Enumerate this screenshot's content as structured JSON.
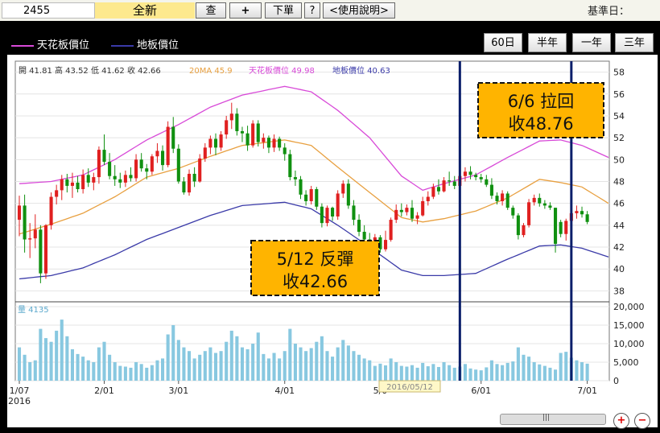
{
  "toolbar": {
    "stock_code": "2455",
    "stock_name": "全新",
    "search_label": "查",
    "add_label": "+",
    "order_label": "下單",
    "help_label": "?",
    "manual_label": "<使用說明>",
    "base_date_label": "基準日："
  },
  "legend": {
    "upper_band": "天花板價位",
    "lower_band": "地板價位",
    "upper_color": "#d84ad8",
    "lower_color": "#3a3aa8"
  },
  "ranges": [
    "60日",
    "半年",
    "一年",
    "三年"
  ],
  "info_line": {
    "ohlc": "開 41.81 高 43.52 低 41.62 收 42.66",
    "ma": "20MA 45.9",
    "upper": "天花板價位 49.98",
    "lower": "地板價位 40.63"
  },
  "volume_label": "量 4135",
  "annotations": [
    {
      "line1": "6/6 拉回",
      "line2": "收48.76",
      "date_index": 104
    },
    {
      "line1": "5/12 反彈",
      "line2": "收42.66",
      "date_index": 83
    }
  ],
  "cursor_date": "2016/05/12",
  "colors": {
    "up": "#e02020",
    "down": "#109010",
    "ma": "#e8a040",
    "volume": "#88c8e0",
    "vline": "#0a1e6a",
    "callout": "#ffb400"
  },
  "chart_data": {
    "type": "candlestick",
    "price_axis": {
      "ticks": [
        38,
        40,
        42,
        44,
        46,
        48,
        50,
        52,
        54,
        56,
        58
      ],
      "range": [
        37,
        59
      ]
    },
    "volume_axis": {
      "ticks": [
        "0",
        "5,000",
        "10,000",
        "15,000",
        "20,000"
      ],
      "range": [
        0,
        20000
      ]
    },
    "x_ticks": [
      {
        "label": "1/07\n2016",
        "index": 0
      },
      {
        "label": "2/01",
        "index": 16
      },
      {
        "label": "3/01",
        "index": 30
      },
      {
        "label": "4/01",
        "index": 50
      },
      {
        "label": "5/0",
        "index": 68
      },
      {
        "label": "6/01",
        "index": 87
      },
      {
        "label": "7/01",
        "index": 107
      }
    ],
    "n": 112,
    "series": [
      {
        "name": "天花板價位",
        "points": [
          [
            0,
            47.8
          ],
          [
            6,
            48
          ],
          [
            12,
            48.6
          ],
          [
            18,
            50
          ],
          [
            24,
            51.8
          ],
          [
            30,
            53.2
          ],
          [
            36,
            54.8
          ],
          [
            42,
            55.9
          ],
          [
            50,
            56.7
          ],
          [
            55,
            56.2
          ],
          [
            60,
            54.5
          ],
          [
            66,
            52
          ],
          [
            72,
            48.5
          ],
          [
            76,
            47.2
          ],
          [
            80,
            47.8
          ],
          [
            86,
            48.6
          ],
          [
            92,
            50.2
          ],
          [
            98,
            51.7
          ],
          [
            102,
            51.8
          ],
          [
            106,
            51.3
          ],
          [
            111,
            50.2
          ]
        ]
      },
      {
        "name": "地板價位",
        "points": [
          [
            0,
            39.1
          ],
          [
            6,
            39.4
          ],
          [
            12,
            40.1
          ],
          [
            18,
            41.3
          ],
          [
            24,
            42.7
          ],
          [
            30,
            43.8
          ],
          [
            36,
            44.9
          ],
          [
            42,
            45.8
          ],
          [
            50,
            46.1
          ],
          [
            55,
            45.5
          ],
          [
            60,
            44
          ],
          [
            66,
            42
          ],
          [
            72,
            39.9
          ],
          [
            76,
            39.4
          ],
          [
            80,
            39.4
          ],
          [
            86,
            39.6
          ],
          [
            92,
            40.9
          ],
          [
            98,
            42.1
          ],
          [
            102,
            42.2
          ],
          [
            106,
            41.9
          ],
          [
            111,
            41.1
          ]
        ]
      },
      {
        "name": "20MA",
        "points": [
          [
            0,
            43.2
          ],
          [
            6,
            44.1
          ],
          [
            12,
            45.1
          ],
          [
            18,
            46.6
          ],
          [
            24,
            48.4
          ],
          [
            30,
            49.2
          ],
          [
            36,
            50.3
          ],
          [
            42,
            51.3
          ],
          [
            50,
            51.8
          ],
          [
            55,
            51.3
          ],
          [
            60,
            49.3
          ],
          [
            66,
            47
          ],
          [
            72,
            44.7
          ],
          [
            76,
            44.3
          ],
          [
            80,
            44.6
          ],
          [
            86,
            45.3
          ],
          [
            92,
            46.5
          ],
          [
            98,
            48.2
          ],
          [
            102,
            47.9
          ],
          [
            106,
            47.5
          ],
          [
            111,
            46
          ]
        ]
      }
    ],
    "candles": [
      [
        44.5,
        46.7,
        43,
        45.8,
        9000
      ],
      [
        45.8,
        46.8,
        41.5,
        42.7,
        7000
      ],
      [
        42.7,
        44.2,
        41,
        42.8,
        5000
      ],
      [
        42.8,
        45,
        41.9,
        43.6,
        5500
      ],
      [
        43.6,
        44,
        38.7,
        39.6,
        14000
      ],
      [
        39.6,
        44.1,
        39.1,
        44,
        11500
      ],
      [
        44,
        47,
        43.6,
        46.6,
        10500
      ],
      [
        46.6,
        47.7,
        45.9,
        47.2,
        13500
      ],
      [
        47.2,
        48.6,
        46.3,
        48.2,
        16500
      ],
      [
        48.2,
        48.7,
        47,
        47.6,
        12000
      ],
      [
        47.6,
        48.8,
        46.5,
        47.9,
        8500
      ],
      [
        47.9,
        48.5,
        47,
        47.3,
        7200
      ],
      [
        47.3,
        49.1,
        46.9,
        48.6,
        6500
      ],
      [
        48.6,
        49.2,
        47.5,
        47.9,
        5500
      ],
      [
        47.9,
        48.8,
        47.2,
        48.4,
        5000
      ],
      [
        48.4,
        51.2,
        47.8,
        50.9,
        9000
      ],
      [
        50.9,
        52.3,
        49.5,
        49.8,
        10500
      ],
      [
        49.8,
        50.6,
        48.2,
        48.5,
        7000
      ],
      [
        48.5,
        49.5,
        47.6,
        48.2,
        5000
      ],
      [
        48.2,
        48.8,
        47.4,
        47.9,
        4000
      ],
      [
        47.9,
        49,
        47.5,
        48.6,
        3800
      ],
      [
        48.6,
        49.3,
        48,
        48.3,
        3500
      ],
      [
        48.3,
        50.5,
        48,
        50,
        5000
      ],
      [
        50,
        50.6,
        48.9,
        49.2,
        4500
      ],
      [
        49.2,
        49.6,
        48.2,
        48.9,
        3500
      ],
      [
        48.9,
        50.5,
        48.6,
        50.3,
        4200
      ],
      [
        50.3,
        51.5,
        49.7,
        50.8,
        5500
      ],
      [
        50.8,
        51.3,
        49,
        49.5,
        6000
      ],
      [
        49.5,
        53.5,
        49.3,
        53,
        12500
      ],
      [
        53,
        53.9,
        50.6,
        51,
        15000
      ],
      [
        51,
        51.4,
        47.8,
        48,
        11000
      ],
      [
        48,
        48.4,
        46.8,
        47,
        9000
      ],
      [
        47,
        49.1,
        46.7,
        48.7,
        8000
      ],
      [
        48.7,
        49.3,
        47.5,
        48,
        6000
      ],
      [
        48,
        50.5,
        47.9,
        50.1,
        7000
      ],
      [
        50.1,
        51.5,
        49.8,
        51.1,
        8000
      ],
      [
        51.1,
        52.2,
        50.5,
        51.9,
        9000
      ],
      [
        51.9,
        52.4,
        50.4,
        51.1,
        7500
      ],
      [
        51.1,
        52.6,
        50.8,
        52.3,
        8000
      ],
      [
        52.3,
        54,
        51.9,
        53.6,
        10500
      ],
      [
        53.6,
        55.2,
        52.8,
        54.2,
        13500
      ],
      [
        54.2,
        54.7,
        52.2,
        52.6,
        12000
      ],
      [
        52.6,
        53,
        51.6,
        52.4,
        9000
      ],
      [
        52.4,
        53.1,
        50.8,
        51.3,
        8500
      ],
      [
        51.3,
        53.6,
        51.1,
        53.3,
        10000
      ],
      [
        53.3,
        53.6,
        51.2,
        51.6,
        13000
      ],
      [
        51.6,
        52.4,
        51,
        52,
        7200
      ],
      [
        52,
        52.2,
        50.6,
        51.1,
        6000
      ],
      [
        51.1,
        52.3,
        50.7,
        51.9,
        7500
      ],
      [
        51.9,
        52.1,
        50.8,
        51.1,
        6000
      ],
      [
        51.1,
        51.5,
        49.9,
        50.5,
        8000
      ],
      [
        50.5,
        50.9,
        48.1,
        48.4,
        14000
      ],
      [
        48.4,
        49,
        47.6,
        48.2,
        10000
      ],
      [
        48.2,
        48.5,
        46.4,
        46.8,
        9000
      ],
      [
        46.8,
        47.2,
        45.8,
        46.2,
        8000
      ],
      [
        46.2,
        47.6,
        45.9,
        47.3,
        8800
      ],
      [
        47.3,
        47.5,
        45.4,
        45.7,
        10500
      ],
      [
        45.7,
        46,
        43.8,
        44.2,
        12000
      ],
      [
        44.2,
        45.8,
        43.9,
        45.6,
        8000
      ],
      [
        45.6,
        45.7,
        44.4,
        44.8,
        6500
      ],
      [
        44.8,
        47.2,
        44.5,
        46.9,
        9000
      ],
      [
        46.9,
        48.1,
        46.5,
        47.8,
        11000
      ],
      [
        47.8,
        48.2,
        45.5,
        45.8,
        9500
      ],
      [
        45.8,
        46.3,
        44,
        44.5,
        8000
      ],
      [
        44.5,
        45,
        43,
        43.4,
        7000
      ],
      [
        43.4,
        44,
        42.3,
        42.7,
        6000
      ],
      [
        42.7,
        43.3,
        41.9,
        42.2,
        5500
      ],
      [
        42.2,
        43.2,
        41.9,
        42.9,
        4000
      ],
      [
        42.9,
        43.1,
        41.5,
        41.8,
        4600
      ],
      [
        41.8,
        43.5,
        41.6,
        42.66,
        4135
      ],
      [
        42.66,
        44.7,
        42.5,
        44.5,
        6000
      ],
      [
        44.5,
        45.9,
        44.2,
        45.4,
        5000
      ],
      [
        45.4,
        46,
        44.8,
        45.2,
        4000
      ],
      [
        45.2,
        45.9,
        44.9,
        45.6,
        3800
      ],
      [
        45.6,
        46.3,
        44.3,
        44.6,
        4200
      ],
      [
        44.6,
        45.2,
        44.1,
        44.9,
        3500
      ],
      [
        44.9,
        46.6,
        44.8,
        46.2,
        4800
      ],
      [
        46.2,
        47.1,
        45.8,
        46.6,
        3900
      ],
      [
        46.6,
        47.8,
        46.4,
        47.5,
        4500
      ],
      [
        47.5,
        48.2,
        46.8,
        47.1,
        3700
      ],
      [
        47.1,
        48.4,
        47,
        48.1,
        5000
      ],
      [
        48.1,
        48.9,
        47.6,
        48,
        4200
      ],
      [
        48,
        48.5,
        47.3,
        47.6,
        3500
      ],
      [
        47.6,
        48.8,
        47.4,
        48.5,
        3800
      ],
      [
        48.5,
        49.3,
        48,
        48.9,
        4500
      ],
      [
        48.9,
        49.4,
        48.2,
        48.6,
        3300
      ],
      [
        48.6,
        48.8,
        48.1,
        48.4,
        3000
      ],
      [
        48.4,
        48.7,
        47.9,
        48.2,
        2800
      ],
      [
        48.2,
        48.6,
        47.5,
        47.7,
        3600
      ],
      [
        47.7,
        48.3,
        46.4,
        46.7,
        5500
      ],
      [
        46.7,
        47,
        45.9,
        46.2,
        4500
      ],
      [
        46.2,
        47.2,
        45.8,
        46.9,
        4200
      ],
      [
        46.9,
        47.1,
        45.4,
        45.6,
        4800
      ],
      [
        45.6,
        45.8,
        44.6,
        44.9,
        5200
      ],
      [
        44.9,
        45.1,
        42.7,
        43.1,
        9000
      ],
      [
        43.1,
        44.2,
        42.9,
        44,
        7000
      ],
      [
        44,
        46.4,
        43.8,
        46.1,
        6500
      ],
      [
        46.1,
        46.8,
        45.8,
        46.5,
        5000
      ],
      [
        46.5,
        46.9,
        45.7,
        46,
        4400
      ],
      [
        46,
        46.3,
        45.5,
        45.8,
        4000
      ],
      [
        45.8,
        46.1,
        45.4,
        45.6,
        3500
      ],
      [
        45.6,
        44.3,
        41.5,
        42.3,
        3000
      ],
      [
        44.3,
        44.5,
        42.9,
        43.2,
        7500
      ],
      [
        43.2,
        44.6,
        42.6,
        44.4,
        7800
      ],
      [
        44.4,
        45.4,
        43.9,
        45.1,
        6200
      ],
      [
        45.1,
        45.8,
        44.6,
        45.3,
        5500
      ],
      [
        45.3,
        45.7,
        44.7,
        45,
        5000
      ],
      [
        45,
        45.3,
        44.1,
        44.3,
        4600
      ]
    ]
  }
}
